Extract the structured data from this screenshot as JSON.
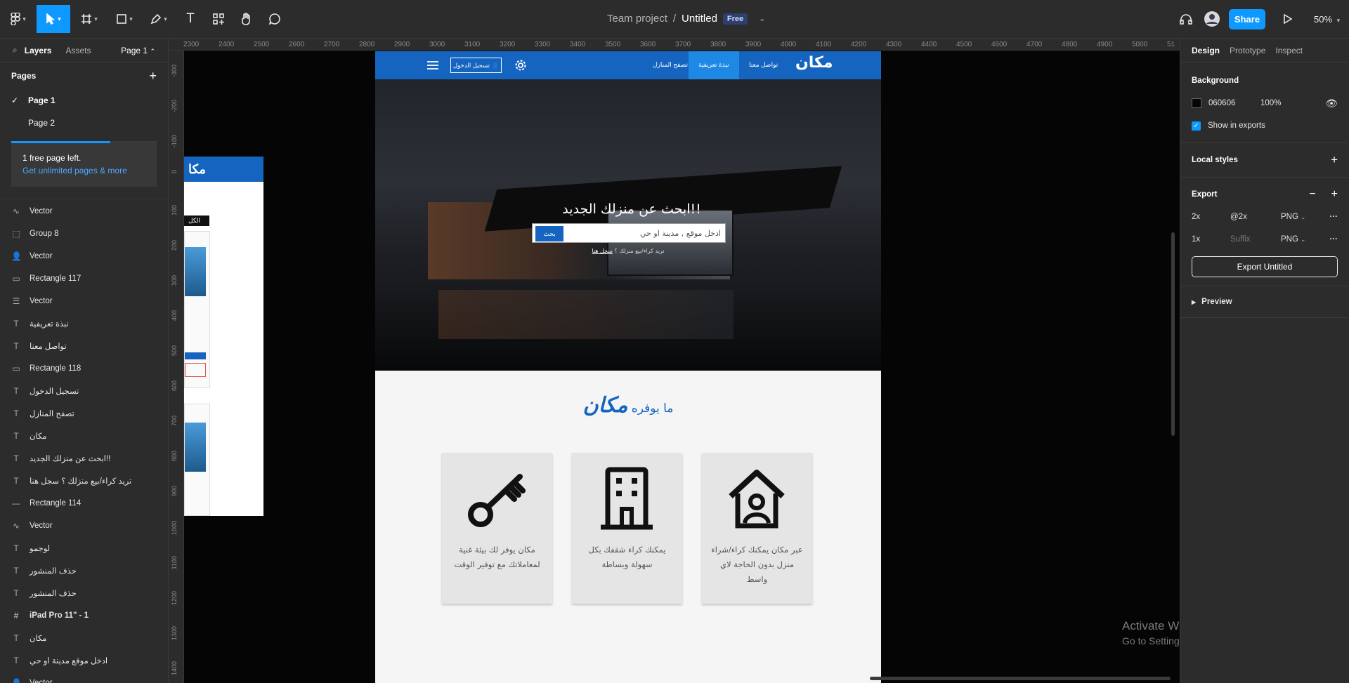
{
  "toolbar": {
    "breadcrumb_team": "Team project",
    "breadcrumb_sep": "/",
    "file_name": "Untitled",
    "plan_badge": "Free",
    "share_label": "Share",
    "zoom": "50%"
  },
  "left_panel": {
    "tab_layers": "Layers",
    "tab_assets": "Assets",
    "page_selector": "Page 1",
    "pages_title": "Pages",
    "pages": [
      "Page 1",
      "Page 2"
    ],
    "promo_line": "1 free page left.",
    "promo_link": "Get unlimited pages & more",
    "pages_progress": 0.68,
    "layers": [
      {
        "name": "Vector",
        "icon": "vector-icon",
        "glyph": "∿"
      },
      {
        "name": "Group 8",
        "icon": "group-icon",
        "glyph": "⬚"
      },
      {
        "name": "Vector",
        "icon": "person-vector-icon",
        "glyph": "👤"
      },
      {
        "name": "Rectangle 117",
        "icon": "rectangle-icon",
        "glyph": "▭"
      },
      {
        "name": "Vector",
        "icon": "menu-vector-icon",
        "glyph": "☰"
      },
      {
        "name": "نبذة تعريفية",
        "icon": "text-icon",
        "glyph": "T"
      },
      {
        "name": "تواصل معنا",
        "icon": "text-icon",
        "glyph": "T"
      },
      {
        "name": "Rectangle 118",
        "icon": "rectangle-icon",
        "glyph": "▭"
      },
      {
        "name": "تسجيل الدخول",
        "icon": "text-icon",
        "glyph": "T"
      },
      {
        "name": "تصفح المنازل",
        "icon": "text-icon",
        "glyph": "T"
      },
      {
        "name": "مكان",
        "icon": "text-icon",
        "glyph": "T"
      },
      {
        "name": "ابحث عن منزلك الجديد!!",
        "icon": "text-icon",
        "glyph": "T"
      },
      {
        "name": "تريد كراء/بيع منزلك ؟ سجل هنا",
        "icon": "text-icon",
        "glyph": "T"
      },
      {
        "name": "Rectangle 114",
        "icon": "line-icon",
        "glyph": "—"
      },
      {
        "name": "Vector",
        "icon": "vector-icon",
        "glyph": "∿"
      },
      {
        "name": "لوجمو",
        "icon": "text-icon",
        "glyph": "T"
      },
      {
        "name": "حذف المنشور",
        "icon": "text-icon",
        "glyph": "T"
      },
      {
        "name": "حذف المنشور",
        "icon": "text-icon",
        "glyph": "T"
      },
      {
        "name": "iPad Pro 11\" - 1",
        "icon": "frame-icon",
        "glyph": "#"
      },
      {
        "name": "مكان",
        "icon": "text-icon",
        "glyph": "T"
      },
      {
        "name": "ادخل موقع مدينة او حي",
        "icon": "text-icon",
        "glyph": "T"
      },
      {
        "name": "Vector",
        "icon": "person-vector-icon",
        "glyph": "👤"
      }
    ]
  },
  "rulers": {
    "top": [
      "2300",
      "2400",
      "2500",
      "2600",
      "2700",
      "2800",
      "2900",
      "3000",
      "3100",
      "3200",
      "3300",
      "3400",
      "3500",
      "3600",
      "3700",
      "3800",
      "3900",
      "4000",
      "4100",
      "4200",
      "4300",
      "4400",
      "4500",
      "4600",
      "4700",
      "4800",
      "4900",
      "5000",
      "51"
    ],
    "left": [
      "-300",
      "-200",
      "-100",
      "0",
      "100",
      "200",
      "300",
      "400",
      "500",
      "600",
      "700",
      "800",
      "900",
      "1000",
      "1100",
      "1200",
      "1300",
      "1400"
    ]
  },
  "mockup": {
    "logo": "مكان",
    "nav_contact": "تواصل معنا",
    "nav_about": "نبذة تعريفية",
    "nav_browse": "تصفح المنازل",
    "nav_login": "تسجيل الدخول",
    "hero_title": "ابحث عن منزلك الجديد!!",
    "search_placeholder": "ادخل موقع , مدينة او حي",
    "search_button": "بحث",
    "hero_sub_prefix": "تريد كراء/بيع منزلك ؟ ",
    "hero_sub_link": "سجل هنا",
    "offer_title_prefix": "ما يوفره ",
    "offer_title_brand": "مكان",
    "cards": [
      {
        "icon": "house-person-icon",
        "text": "عبر مكان يمكنك كراء/شراء منزل بدون الحاجة لاي واسط"
      },
      {
        "icon": "building-icon",
        "text": "يمكنك كراء شقفك بكل سهولة وبساطة"
      },
      {
        "icon": "key-icon",
        "text": "مكان يوفر لك بيئة غنية لمعاملاتك مع توفير الوقت"
      }
    ],
    "side_frame_logo": "مكا",
    "side_frame_tag": "الكل"
  },
  "right_panel": {
    "tab_design": "Design",
    "tab_prototype": "Prototype",
    "tab_inspect": "Inspect",
    "background_title": "Background",
    "bg_hex": "060606",
    "bg_opacity": "100%",
    "show_in_exports": "Show in exports",
    "local_styles": "Local styles",
    "export_title": "Export",
    "exports": [
      {
        "scale": "2x",
        "suffix": "@2x",
        "format": "PNG"
      },
      {
        "scale": "1x",
        "suffix": "Suffix",
        "format": "PNG"
      }
    ],
    "export_button": "Export Untitled",
    "preview": "Preview"
  },
  "watermark": {
    "line1": "Activate Windows",
    "line2": "Go to Settings to activate Windows."
  },
  "help": "?"
}
